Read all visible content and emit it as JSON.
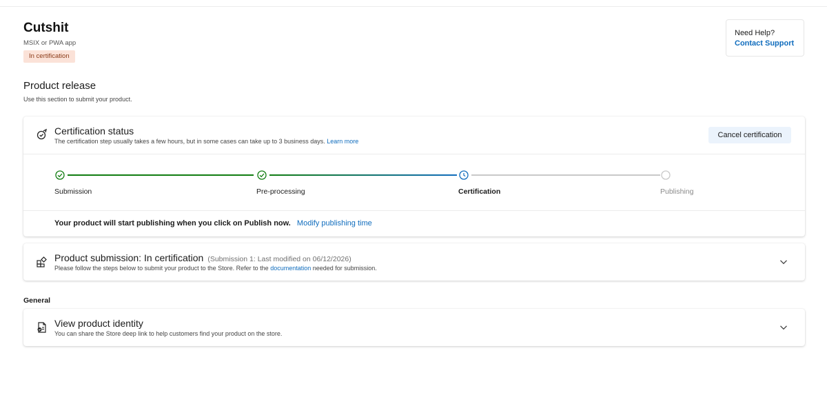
{
  "app": {
    "title": "Cutshit",
    "type": "MSIX or PWA app",
    "status_badge": "In certification"
  },
  "help": {
    "title": "Need Help?",
    "link": "Contact Support"
  },
  "product_release": {
    "title": "Product release",
    "subtitle": "Use this section to submit your product."
  },
  "certification": {
    "icon": "certificate-icon",
    "title": "Certification status",
    "description": "The certification step usually takes a few hours, but in some cases can take up to 3 business days.",
    "learn_more": "Learn more",
    "cancel_button": "Cancel certification",
    "steps": [
      {
        "label": "Submission",
        "state": "complete"
      },
      {
        "label": "Pre-processing",
        "state": "complete"
      },
      {
        "label": "Certification",
        "state": "current"
      },
      {
        "label": "Publishing",
        "state": "pending"
      }
    ],
    "publish_note": "Your product will start publishing when you click on Publish now.",
    "modify_link": "Modify publishing time"
  },
  "submission": {
    "icon": "apps-icon",
    "title": "Product submission: In certification",
    "meta": "(Submission 1: Last modified on 06/12/2026)",
    "description_pre": "Please follow the steps below to submit your product to the Store. Refer to the",
    "description_link": "documentation",
    "description_post": "needed for submission."
  },
  "general": {
    "label": "General",
    "identity": {
      "icon": "product-identity-icon",
      "title": "View product identity",
      "description": "You can share the Store deep link to help customers find your product on the store."
    }
  },
  "colors": {
    "complete": "#107c10",
    "current": "#0f6cbd",
    "pending": "#c8c8c8",
    "badge_bg": "#fbe2d8",
    "link": "#0f6cbd"
  }
}
